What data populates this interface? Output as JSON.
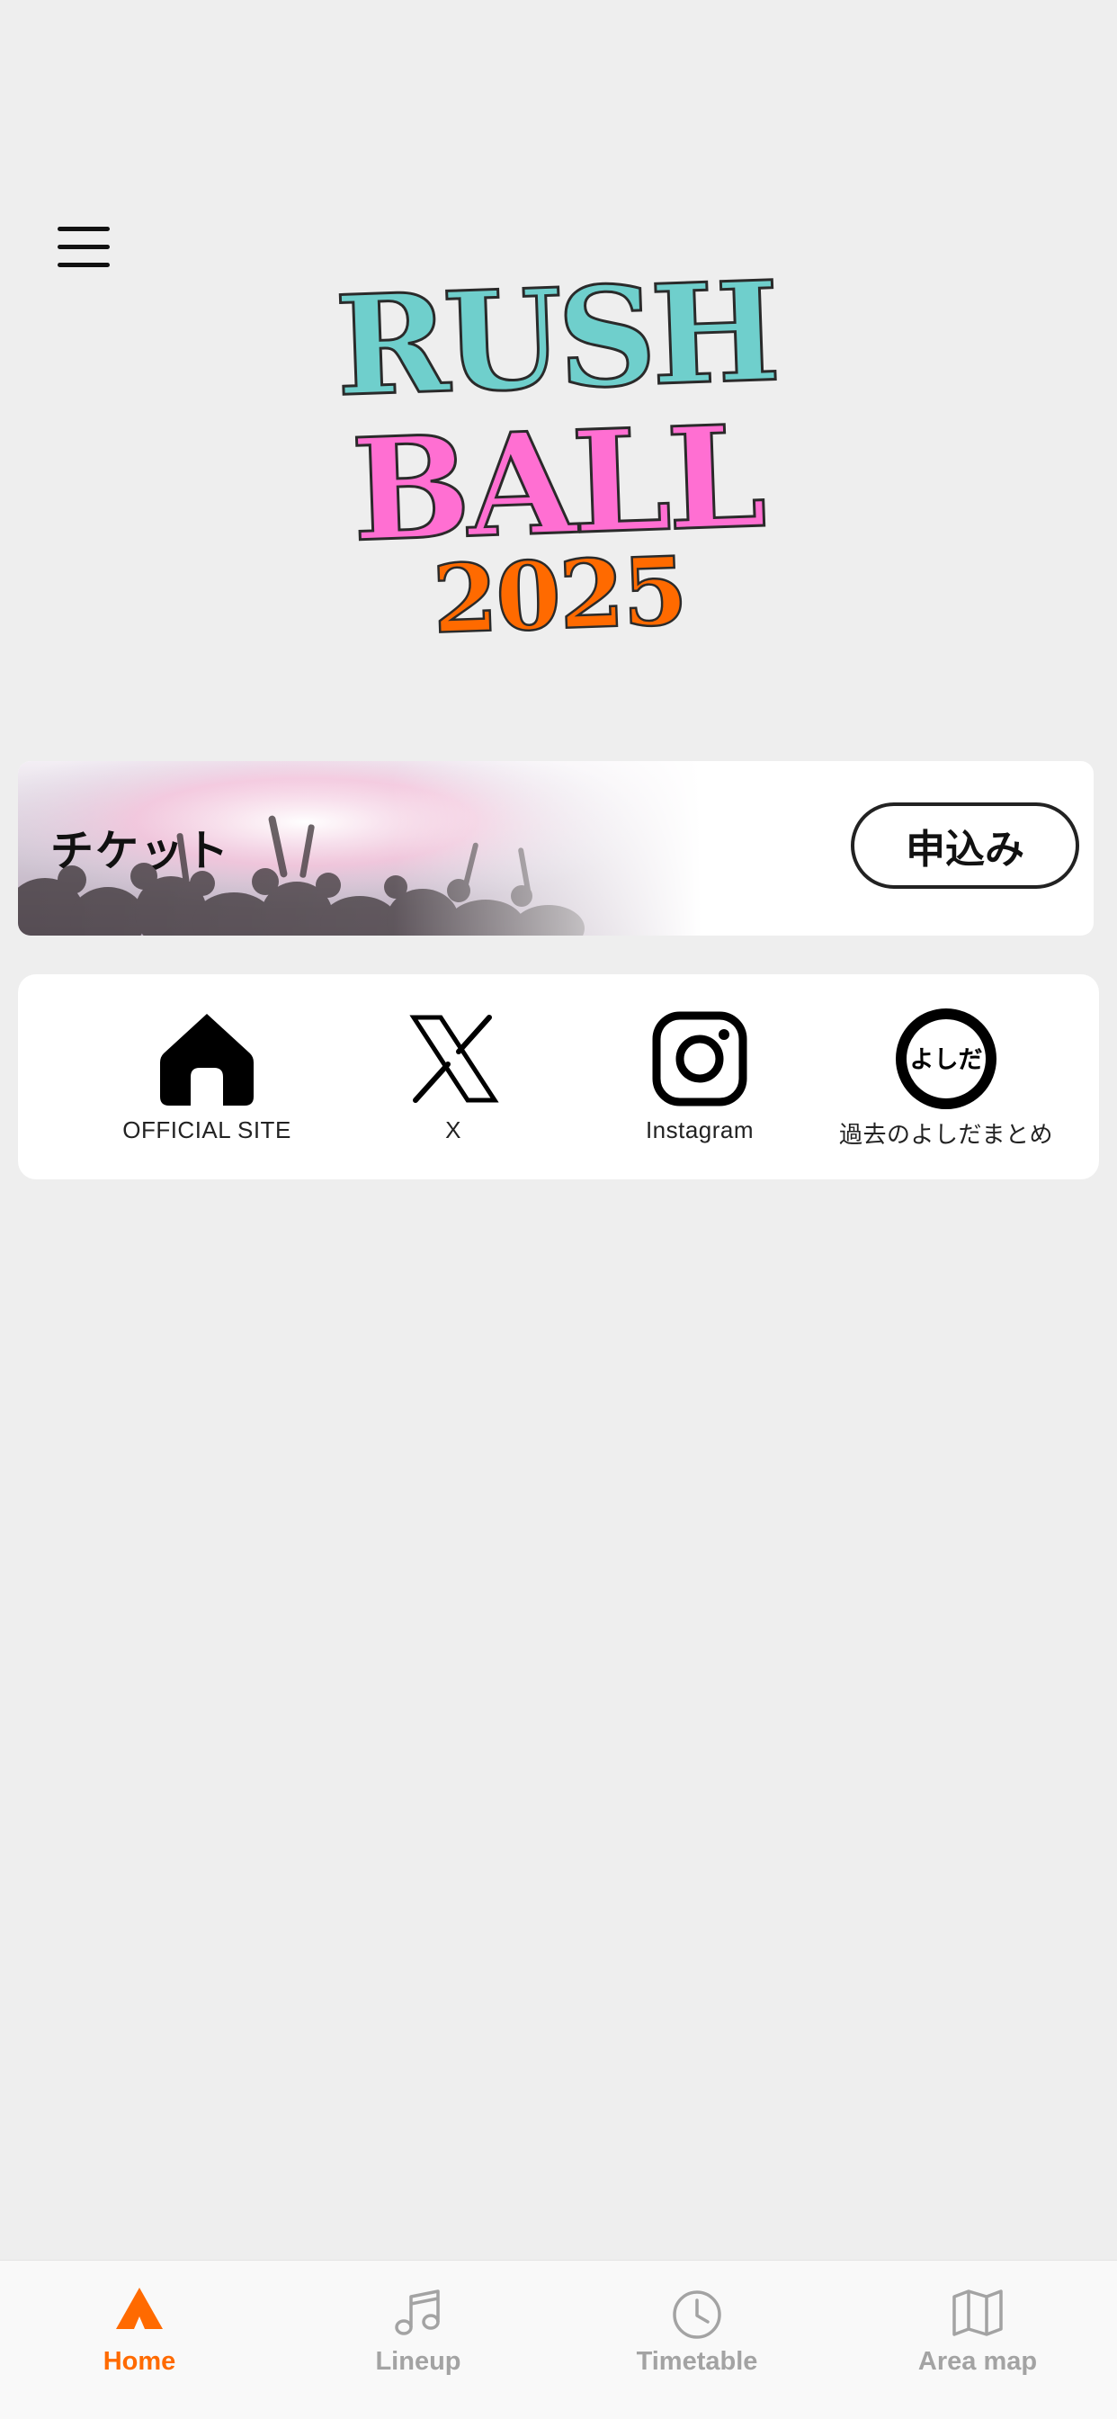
{
  "header": {
    "menu_icon": "hamburger-menu-icon",
    "logo": {
      "line1": "RUSH",
      "line2": "BALL",
      "line3": "2025",
      "colors": {
        "line1": "#6fcfcc",
        "line2": "#ff6fd2",
        "line3": "#ff6a00",
        "outline": "#2a2a2a"
      }
    }
  },
  "ticket": {
    "label": "チケット",
    "button_label": "申込み",
    "background": "concert-crowd-photo"
  },
  "links": [
    {
      "label": "OFFICIAL SITE",
      "icon": "home-icon"
    },
    {
      "label": "X",
      "icon": "x-logo-icon"
    },
    {
      "label": "Instagram",
      "icon": "instagram-icon"
    },
    {
      "label": "過去のよしだまとめ",
      "icon": "yoshida-circle-icon",
      "icon_text": "よしだ"
    }
  ],
  "tabbar": {
    "active_color": "#ff6a00",
    "inactive_color": "#a3a3a3",
    "tabs": [
      {
        "label": "Home",
        "icon": "tent-icon",
        "active": true
      },
      {
        "label": "Lineup",
        "icon": "music-note-icon",
        "active": false
      },
      {
        "label": "Timetable",
        "icon": "clock-icon",
        "active": false
      },
      {
        "label": "Area map",
        "icon": "map-icon",
        "active": false
      }
    ]
  }
}
